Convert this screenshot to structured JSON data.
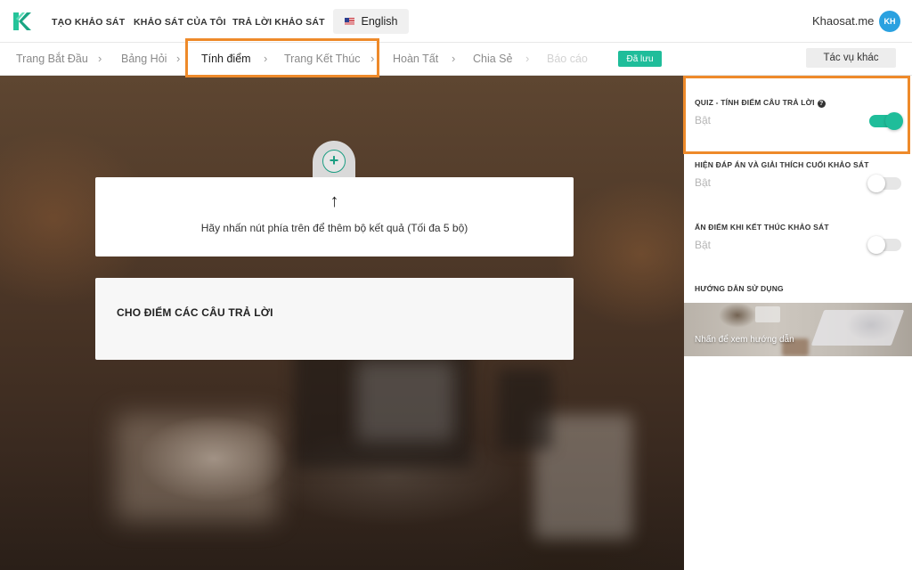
{
  "topbar": {
    "nav": [
      "TẠO KHẢO SÁT",
      "KHẢO SÁT CỦA TÔI",
      "TRẢ LỜI KHẢO SÁT"
    ],
    "language": "English",
    "site_name": "Khaosat.me",
    "avatar_initials": "KH"
  },
  "breadcrumb": {
    "steps": [
      "Trang Bắt Đầu",
      "Bảng Hỏi",
      "Tính điểm",
      "Trang Kết Thúc",
      "Hoàn Tất",
      "Chia Sẻ",
      "Báo cáo"
    ],
    "active_step": "Tính điểm",
    "saved_label": "Đã lưu",
    "other_actions_label": "Tác vụ khác"
  },
  "main": {
    "add_icon": "plus-circle-icon",
    "arrow": "↑",
    "hint": "Hãy nhấn nút phía trên để thêm bộ kết quả (Tối đa 5 bộ)",
    "scoring_title": "CHO ĐIỂM CÁC CÂU TRẢ LỜI"
  },
  "sidebar": {
    "settings": [
      {
        "title": "QUIZ - TÍNH ĐIỂM CÂU TRẢ LỜI",
        "value": "Bật",
        "enabled": true
      },
      {
        "title": "HIỆN ĐÁP ÁN VÀ GIẢI THÍCH CUỐI KHẢO SÁT",
        "value": "Bật",
        "enabled": false
      },
      {
        "title": "ẨN ĐIỂM KHI KẾT THÚC KHẢO SÁT",
        "value": "Bật",
        "enabled": false
      }
    ],
    "guide_title": "HƯỚNG DẪN SỬ DỤNG",
    "guide_cta": "Nhấn để xem hướng dẫn"
  },
  "colors": {
    "accent": "#1fbd9a",
    "highlight": "#ee8a2a",
    "avatar": "#2aa1e0"
  }
}
